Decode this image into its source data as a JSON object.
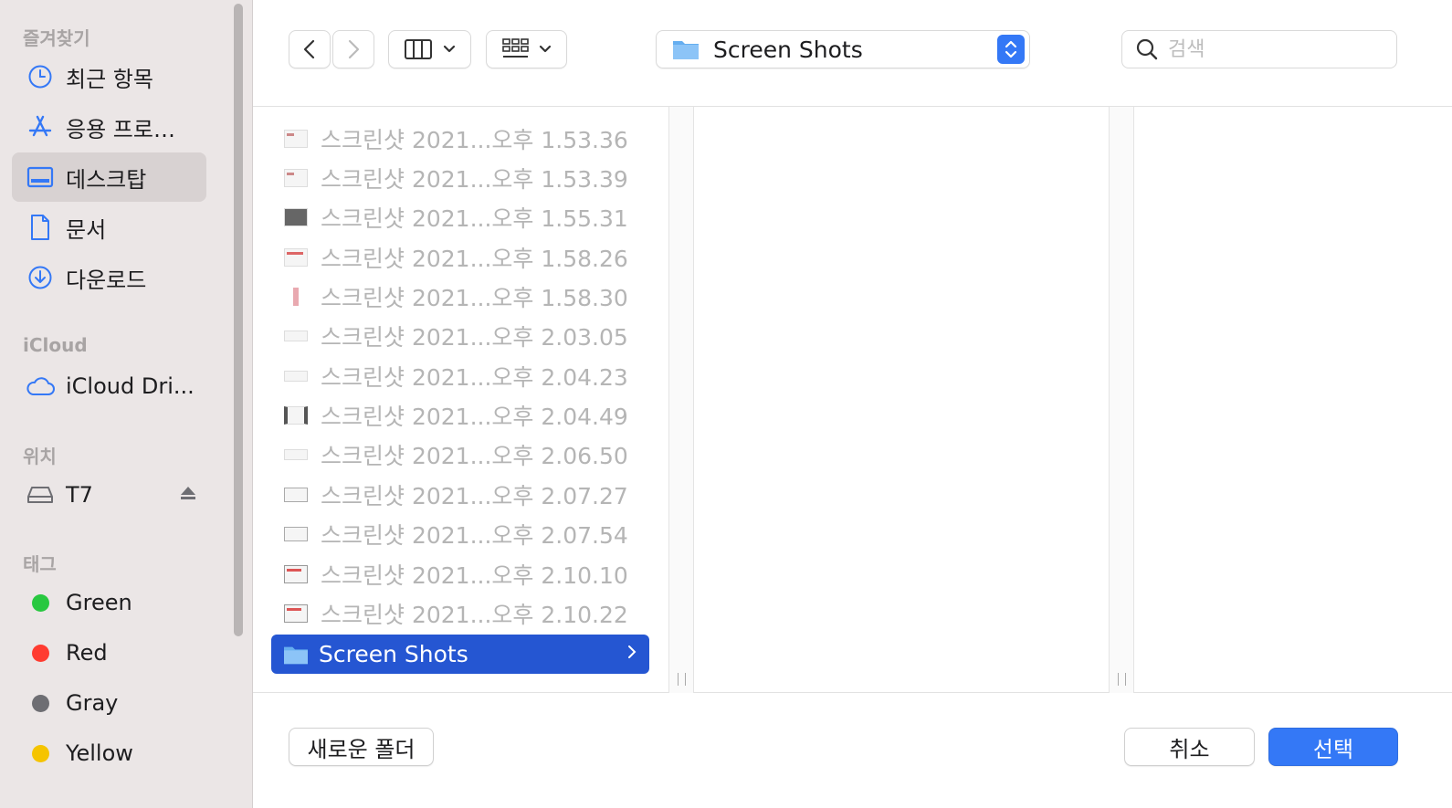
{
  "sidebar": {
    "favorites_heading": "즐겨찾기",
    "favorites": [
      {
        "label": "최근 항목",
        "icon": "clock-icon"
      },
      {
        "label": "응용 프로…",
        "icon": "app-store-icon"
      },
      {
        "label": "데스크탑",
        "icon": "desktop-icon",
        "selected": true
      },
      {
        "label": "문서",
        "icon": "document-icon"
      },
      {
        "label": "다운로드",
        "icon": "download-icon"
      }
    ],
    "icloud_heading": "iCloud",
    "icloud": [
      {
        "label": "iCloud Dri...",
        "icon": "cloud-icon"
      }
    ],
    "locations_heading": "위치",
    "locations": [
      {
        "label": "T7",
        "icon": "drive-icon"
      }
    ],
    "tags_heading": "태그",
    "tags": [
      {
        "label": "Green",
        "color": "#28c840"
      },
      {
        "label": "Red",
        "color": "#ff3b30"
      },
      {
        "label": "Gray",
        "color": "#6e6e73"
      },
      {
        "label": "Yellow",
        "color": "#f5c400"
      }
    ]
  },
  "toolbar": {
    "location": "Screen Shots",
    "search_placeholder": "검색"
  },
  "files": [
    "스크린샷 2021...오후 1.53.36",
    "스크린샷 2021...오후 1.53.39",
    "스크린샷 2021...오후 1.55.31",
    "스크린샷 2021...오후 1.58.26",
    "스크린샷 2021...오후 1.58.30",
    "스크린샷 2021...오후 2.03.05",
    "스크린샷 2021...오후 2.04.23",
    "스크린샷 2021...오후 2.04.49",
    "스크린샷 2021...오후 2.06.50",
    "스크린샷 2021...오후 2.07.27",
    "스크린샷 2021...오후 2.07.54",
    "스크린샷 2021...오후 2.10.10",
    "스크린샷 2021...오후 2.10.22"
  ],
  "selected_folder": "Screen Shots",
  "buttons": {
    "new_folder": "새로운 폴더",
    "cancel": "취소",
    "choose": "선택"
  }
}
